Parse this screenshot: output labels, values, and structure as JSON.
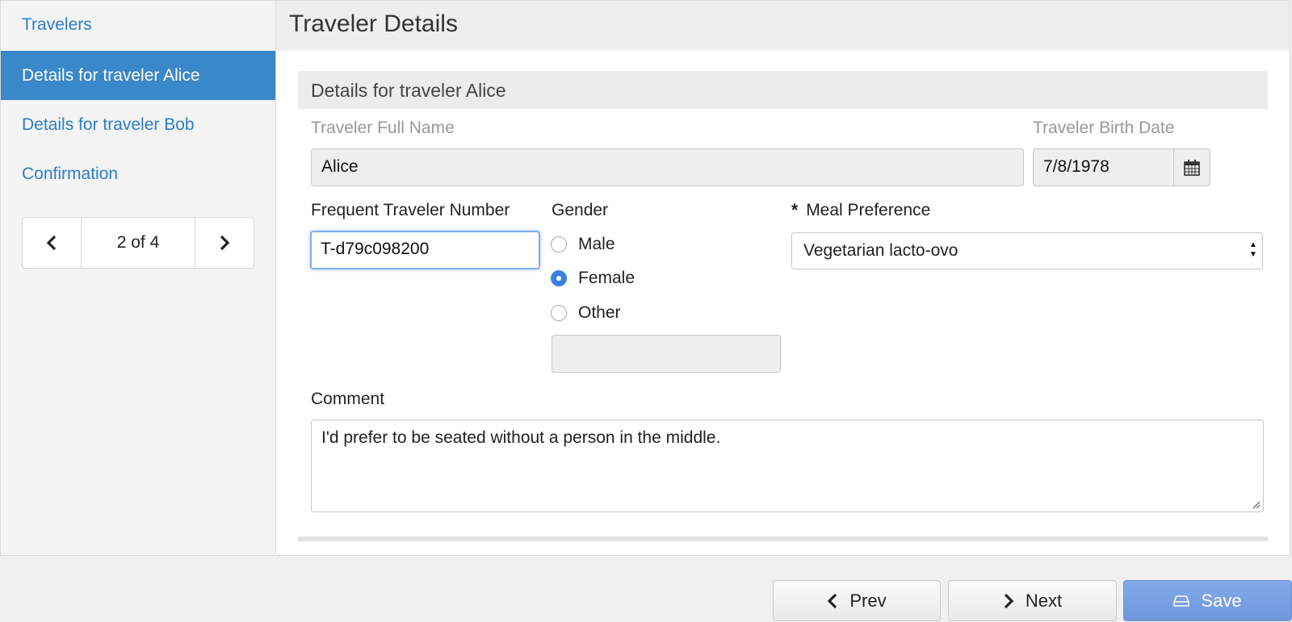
{
  "sidebar": {
    "items": [
      {
        "label": "Travelers"
      },
      {
        "label": "Details for traveler Alice"
      },
      {
        "label": "Details for traveler Bob"
      },
      {
        "label": "Confirmation"
      }
    ],
    "pager": {
      "text": "2 of 4"
    }
  },
  "main": {
    "title": "Traveler Details",
    "panel_title": "Details for traveler Alice"
  },
  "form": {
    "full_name": {
      "label": "Traveler Full Name",
      "value": "Alice"
    },
    "birth_date": {
      "label": "Traveler Birth Date",
      "value": "7/8/1978"
    },
    "frequent_number": {
      "label": "Frequent Traveler Number",
      "value": "T-d79c098200"
    },
    "gender": {
      "label": "Gender",
      "options": [
        {
          "label": "Male",
          "checked": false
        },
        {
          "label": "Female",
          "checked": true
        },
        {
          "label": "Other",
          "checked": false
        }
      ],
      "other_value": ""
    },
    "meal": {
      "required_mark": "*",
      "label": "Meal Preference",
      "value": "Vegetarian lacto-ovo"
    },
    "comment": {
      "label": "Comment",
      "value": "I'd prefer to be seated without a person in the middle."
    }
  },
  "footer": {
    "prev_label": "Prev",
    "next_label": "Next",
    "save_label": "Save"
  },
  "colors": {
    "accent": "#3a87c9",
    "link": "#2a7ec8",
    "radio_checked": "#3b82e0",
    "save_button": "#7aa1e3"
  }
}
